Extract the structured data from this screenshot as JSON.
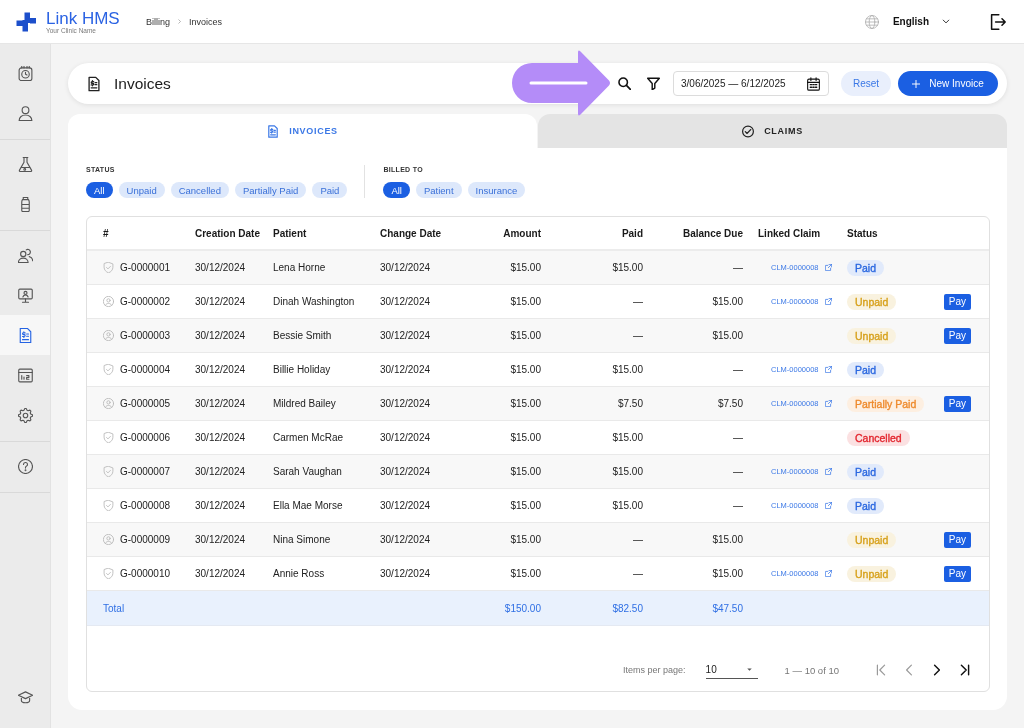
{
  "header": {
    "brand": "Link HMS",
    "tagline": "Your Clinic Name",
    "breadcrumbs": [
      "Billing",
      "Invoices"
    ],
    "language": "English"
  },
  "sidebar": {
    "groups": [
      {
        "items": [
          {
            "selected": false
          },
          {
            "selected": false
          }
        ]
      },
      {
        "items": [
          {
            "selected": false
          },
          {
            "selected": false
          }
        ]
      },
      {
        "items": [
          {
            "selected": false
          },
          {
            "selected": false
          },
          {
            "selected": true
          },
          {
            "selected": false
          },
          {
            "selected": false
          }
        ]
      },
      {
        "items": [
          {
            "selected": false
          }
        ]
      }
    ],
    "footer_items": [
      {
        "selected": false
      }
    ]
  },
  "toolbar": {
    "title": "Invoices",
    "date_range": "3/06/2025 — 6/12/2025",
    "reset": "Reset",
    "new_invoice": "New Invoice"
  },
  "tabs": [
    {
      "label": "INVOICES",
      "selected": true
    },
    {
      "label": "CLAIMS",
      "selected": false
    }
  ],
  "filters": [
    {
      "label": "STATUS",
      "chips": [
        {
          "label": "All",
          "selected": true
        },
        {
          "label": "Unpaid",
          "selected": false
        },
        {
          "label": "Cancelled",
          "selected": false
        },
        {
          "label": "Partially Paid",
          "selected": false
        },
        {
          "label": "Paid",
          "selected": false
        }
      ]
    },
    {
      "label": "BILLED TO",
      "chips": [
        {
          "label": "All",
          "selected": true
        },
        {
          "label": "Patient",
          "selected": false
        },
        {
          "label": "Insurance",
          "selected": false
        }
      ]
    }
  ],
  "table": {
    "columns": [
      "#",
      "Creation Date",
      "Patient",
      "Change Date",
      "Amount",
      "Paid",
      "Balance Due",
      "Linked Claim",
      "Status"
    ],
    "rows": [
      {
        "insurance": true,
        "id": "G-0000001",
        "created": "30/12/2024",
        "patient": "Lena Horne",
        "changed": "30/12/2024",
        "amount": "$15.00",
        "paid": "$15.00",
        "balance_due": "—",
        "linked_claim": "CLM-0000008",
        "status": {
          "label": "Paid",
          "color": "#2b68e0"
        }
      },
      {
        "insurance": false,
        "id": "G-0000002",
        "created": "30/12/2024",
        "patient": "Dinah Washington",
        "changed": "30/12/2024",
        "amount": "$15.00",
        "paid": "—",
        "balance_due": "$15.00",
        "linked_claim": "CLM-0000008",
        "status": {
          "label": "Unpaid",
          "color": "#d7a11c"
        },
        "action": "Pay"
      },
      {
        "insurance": false,
        "id": "G-0000003",
        "created": "30/12/2024",
        "patient": "Bessie Smith",
        "changed": "30/12/2024",
        "amount": "$15.00",
        "paid": "—",
        "balance_due": "$15.00",
        "status": {
          "label": "Unpaid",
          "color": "#d7a11c"
        },
        "action": "Pay"
      },
      {
        "insurance": true,
        "id": "G-0000004",
        "created": "30/12/2024",
        "patient": "Billie Holiday",
        "changed": "30/12/2024",
        "amount": "$15.00",
        "paid": "$15.00",
        "balance_due": "—",
        "linked_claim": "CLM-0000008",
        "status": {
          "label": "Paid",
          "color": "#2b68e0"
        }
      },
      {
        "insurance": false,
        "id": "G-0000005",
        "created": "30/12/2024",
        "patient": "Mildred Bailey",
        "changed": "30/12/2024",
        "amount": "$15.00",
        "paid": "$7.50",
        "balance_due": "$7.50",
        "linked_claim": "CLM-0000008",
        "status": {
          "label": "Partially Paid",
          "color": "#ee8a2c"
        },
        "action": "Pay"
      },
      {
        "insurance": true,
        "id": "G-0000006",
        "created": "30/12/2024",
        "patient": "Carmen McRae",
        "changed": "30/12/2024",
        "amount": "$15.00",
        "paid": "$15.00",
        "balance_due": "—",
        "status": {
          "label": "Cancelled",
          "color": "#e3262f"
        }
      },
      {
        "insurance": true,
        "id": "G-0000007",
        "created": "30/12/2024",
        "patient": "Sarah Vaughan",
        "changed": "30/12/2024",
        "amount": "$15.00",
        "paid": "$15.00",
        "balance_due": "—",
        "linked_claim": "CLM-0000008",
        "status": {
          "label": "Paid",
          "color": "#2b68e0"
        }
      },
      {
        "insurance": true,
        "id": "G-0000008",
        "created": "30/12/2024",
        "patient": "Ella Mae Morse",
        "changed": "30/12/2024",
        "amount": "$15.00",
        "paid": "$15.00",
        "balance_due": "—",
        "linked_claim": "CLM-0000008",
        "status": {
          "label": "Paid",
          "color": "#2b68e0"
        }
      },
      {
        "insurance": false,
        "id": "G-0000009",
        "created": "30/12/2024",
        "patient": "Nina Simone",
        "changed": "30/12/2024",
        "amount": "$15.00",
        "paid": "—",
        "balance_due": "$15.00",
        "status": {
          "label": "Unpaid",
          "color": "#d7a11c"
        },
        "action": "Pay"
      },
      {
        "insurance": true,
        "id": "G-0000010",
        "created": "30/12/2024",
        "patient": "Annie Ross",
        "changed": "30/12/2024",
        "amount": "$15.00",
        "paid": "—",
        "balance_due": "$15.00",
        "linked_claim": "CLM-0000008",
        "status": {
          "label": "Unpaid",
          "color": "#d7a11c"
        },
        "action": "Pay"
      }
    ],
    "total": {
      "label": "Total",
      "amount": "$150.00",
      "paid": "$82.50",
      "balance_due": "$47.50"
    }
  },
  "pagination": {
    "items_per_page_label": "Items per page:",
    "page_size": "10",
    "range": "1 — 10 of 10",
    "buttons": [
      {
        "disabled": true
      },
      {
        "disabled": true
      },
      {
        "disabled": false
      },
      {
        "disabled": false
      }
    ]
  }
}
